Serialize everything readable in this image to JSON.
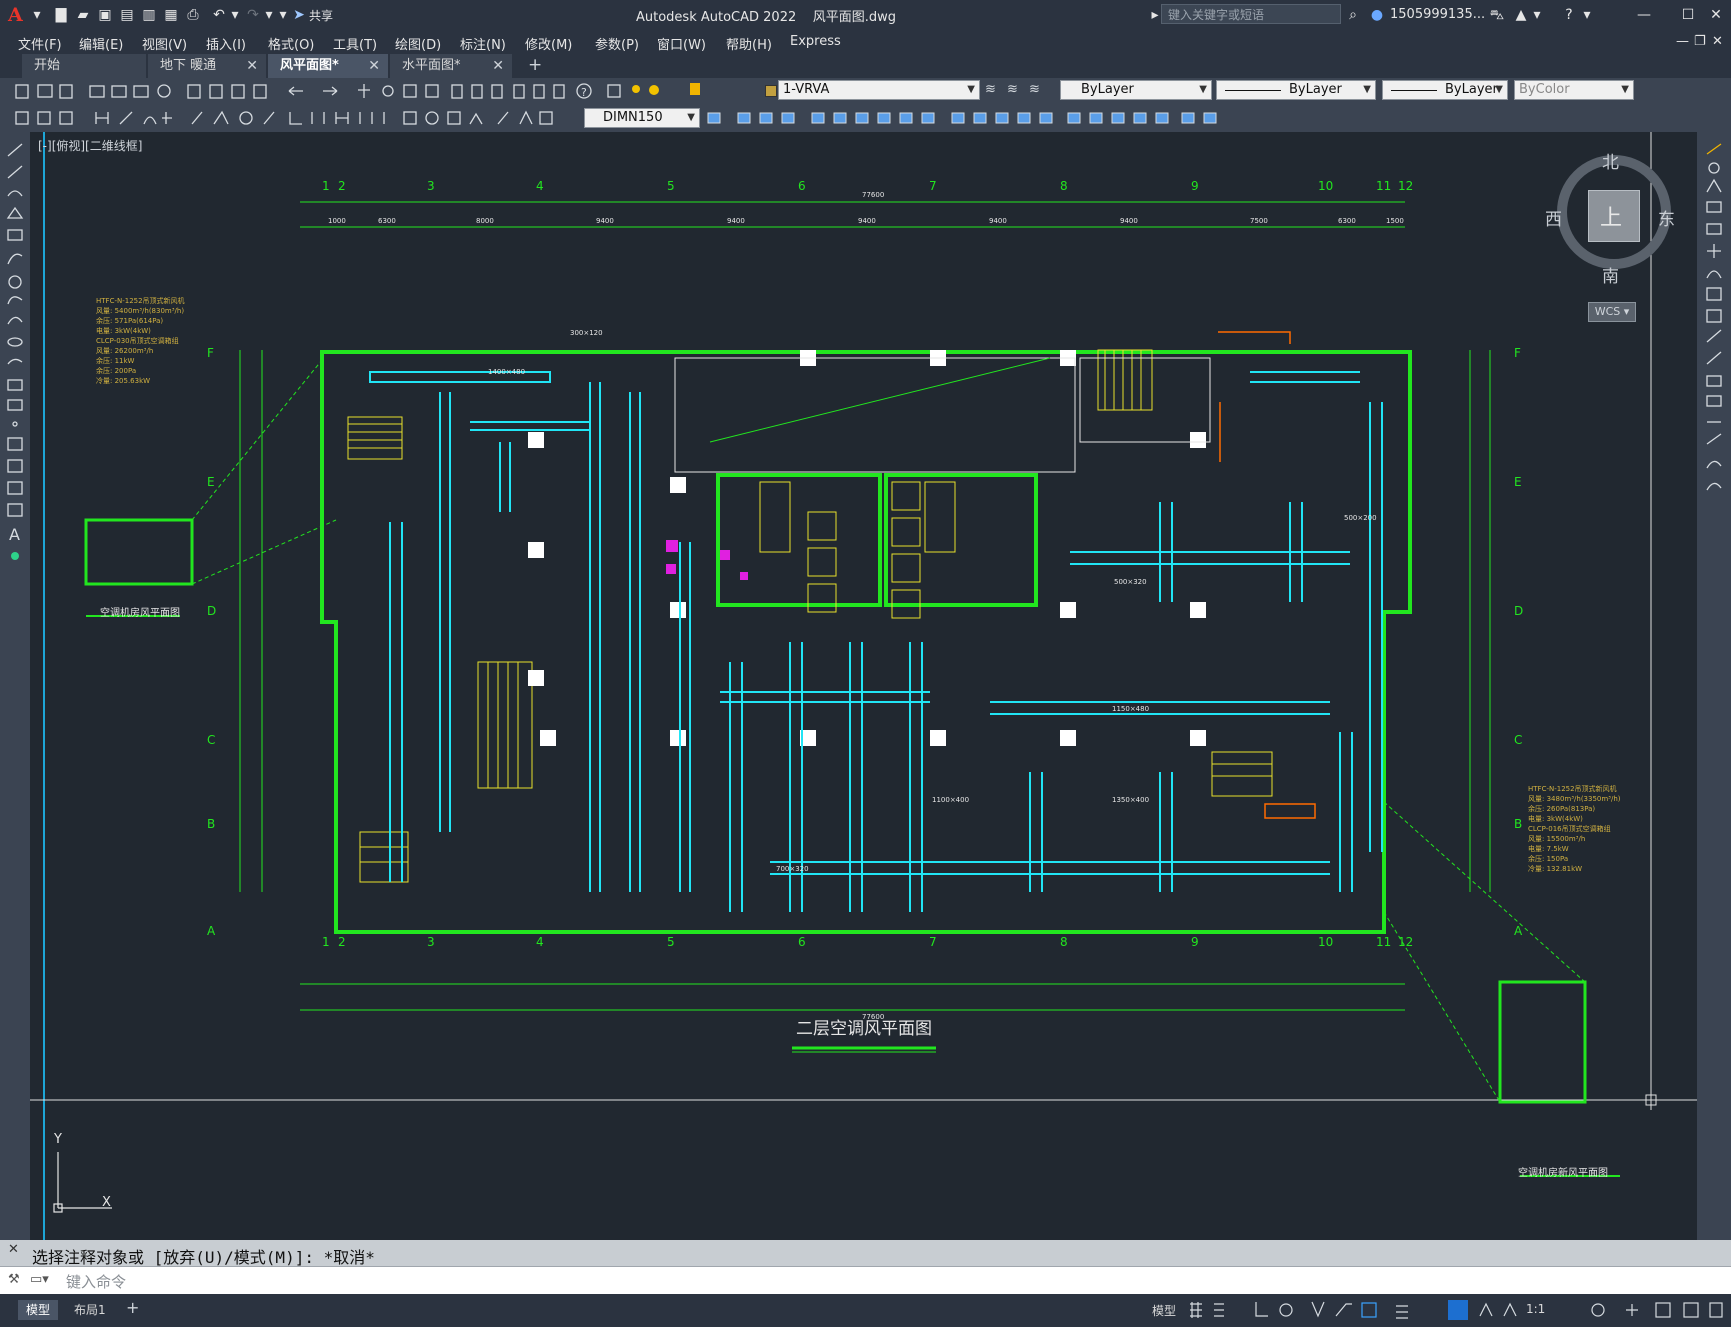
{
  "app": {
    "title": "Autodesk AutoCAD 2022    风平面图.dwg",
    "share_label": "共享",
    "search_placeholder": "键入关键字或短语",
    "user": "1505999135...",
    "logo": "A"
  },
  "menus": [
    "文件(F)",
    "编辑(E)",
    "视图(V)",
    "插入(I)",
    "格式(O)",
    "工具(T)",
    "绘图(D)",
    "标注(N)",
    "修改(M)",
    "参数(P)",
    "窗口(W)",
    "帮助(H)",
    "Express"
  ],
  "tabs": [
    {
      "label": "开始",
      "closable": false
    },
    {
      "label": "地下 暖通",
      "closable": true
    },
    {
      "label": "风平面图*",
      "closable": true,
      "active": true
    },
    {
      "label": "水平面图*",
      "closable": true
    }
  ],
  "toolbar": {
    "layer": "1-VRVA",
    "color": "ByLayer",
    "linetype": "ByLayer",
    "lineweight": "ByLayer",
    "plotstyle": "ByColor",
    "dimstyle": "DIMN150"
  },
  "viewport": {
    "label": "[-][俯视][二维线框]",
    "compass": {
      "n": "北",
      "s": "南",
      "e": "东",
      "w": "西",
      "face": "上"
    },
    "wcs": "WCS ▾"
  },
  "drawing": {
    "title": "二层空调风平面图",
    "sub_left": "空调机房风平面图",
    "sub_right": "空调机房新风平面图",
    "grid_top": [
      "1",
      "2",
      "3",
      "4",
      "5",
      "6",
      "7",
      "8",
      "9",
      "10",
      "11",
      "12"
    ],
    "grid_side": [
      "F",
      "E",
      "D",
      "C",
      "B",
      "A"
    ],
    "total_dim": "77600",
    "spans": [
      "1000",
      "6300",
      "8000",
      "9400",
      "9400",
      "9400",
      "9400",
      "9400",
      "7500",
      "6300",
      "1500"
    ],
    "notes_left": [
      "HTFC-N-1252吊顶式新风机",
      "风量: 5400m³/h(830m³/h)",
      "余压: 571Pa(614Pa)",
      "电量: 3kW(4kW)",
      "CLCP-030吊顶式空调箱组",
      "风量: 26200m³/h",
      "余压: 11kW",
      "余压: 200Pa",
      "冷量: 205.63kW"
    ],
    "notes_right": [
      "HTFC-N-1252吊顶式新风机",
      "风量: 3480m³/h(3350m³/h)",
      "余压: 260Pa(813Pa)",
      "电量: 3kW(4kW)",
      "CLCP-016吊顶式空调箱组",
      "风量: 15500m³/h",
      "电量: 7.5kW",
      "余压: 150Pa",
      "冷量: 132.81kW"
    ],
    "duct_labels": [
      "1400×480",
      "300×120",
      "500×200",
      "1100×400",
      "1350×400",
      "1150×480",
      "700×320",
      "500×320"
    ]
  },
  "command": {
    "history": "选择注释对象或 [放弃(U)/模式(M)]: *取消*",
    "placeholder": "键入命令"
  },
  "status": {
    "tabs": [
      "模型",
      "布局1"
    ],
    "model_btn": "模型",
    "scale": "1:1"
  },
  "colors": {
    "green": "#22e61f",
    "cyan": "#21e5f5",
    "yellow": "#e8e02c",
    "orange": "#ff6a00",
    "magenta": "#e020e0",
    "blue": "#2a4ad8"
  }
}
